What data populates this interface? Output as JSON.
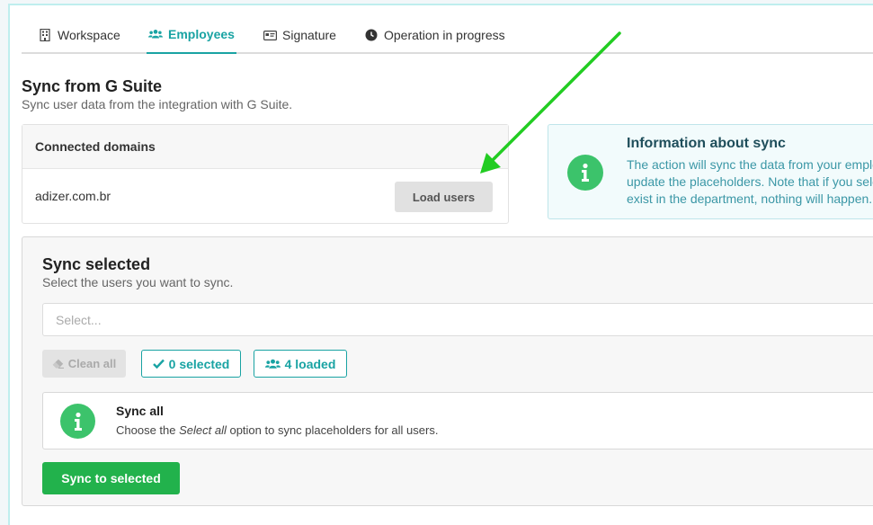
{
  "tabs": [
    {
      "label": "Workspace",
      "icon": "building-icon"
    },
    {
      "label": "Employees",
      "icon": "users-icon",
      "active": true
    },
    {
      "label": "Signature",
      "icon": "id-card-icon"
    },
    {
      "label": "Operation in progress",
      "icon": "clock-icon"
    }
  ],
  "header": {
    "title": "Sync from G Suite",
    "subtitle": "Sync user data from the integration with G Suite."
  },
  "domains": {
    "heading": "Connected domains",
    "items": [
      {
        "name": "adizer.com.br",
        "action_label": "Load users"
      }
    ]
  },
  "info": {
    "title": "Information about sync",
    "lines": [
      "The action will sync the data from your emplo",
      "update the placeholders. Note that if you sele",
      "exist in the department, nothing will happen."
    ]
  },
  "sync_selected": {
    "title": "Sync selected",
    "subtitle": "Select the users you want to sync.",
    "select_placeholder": "Select...",
    "clean_all_label": "Clean all",
    "selected_label": "0 selected",
    "loaded_label": "4 loaded",
    "sync_all": {
      "title": "Sync all",
      "desc_before": "Choose the ",
      "desc_em": "Select all",
      "desc_after": " option to sync placeholders for all users."
    },
    "sync_button_label": "Sync to selected"
  },
  "colors": {
    "accent": "#19a3a3",
    "success": "#22b24c",
    "info_icon": "#3cc36b",
    "arrow": "#22cc22"
  }
}
